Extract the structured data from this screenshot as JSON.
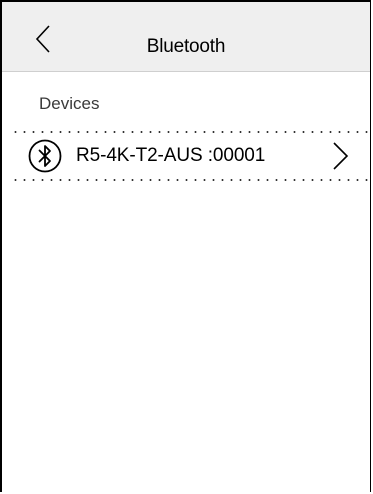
{
  "header": {
    "title": "Bluetooth",
    "back_icon": "chevron-left-icon"
  },
  "devices_section": {
    "label": "Devices",
    "items": [
      {
        "name": "R5-4K-T2-AUS :00001",
        "icon": "bluetooth-icon",
        "trailing_icon": "chevron-right-icon"
      }
    ]
  },
  "colors": {
    "header_background": "#efefef",
    "background": "#ffffff",
    "text": "#000000"
  }
}
